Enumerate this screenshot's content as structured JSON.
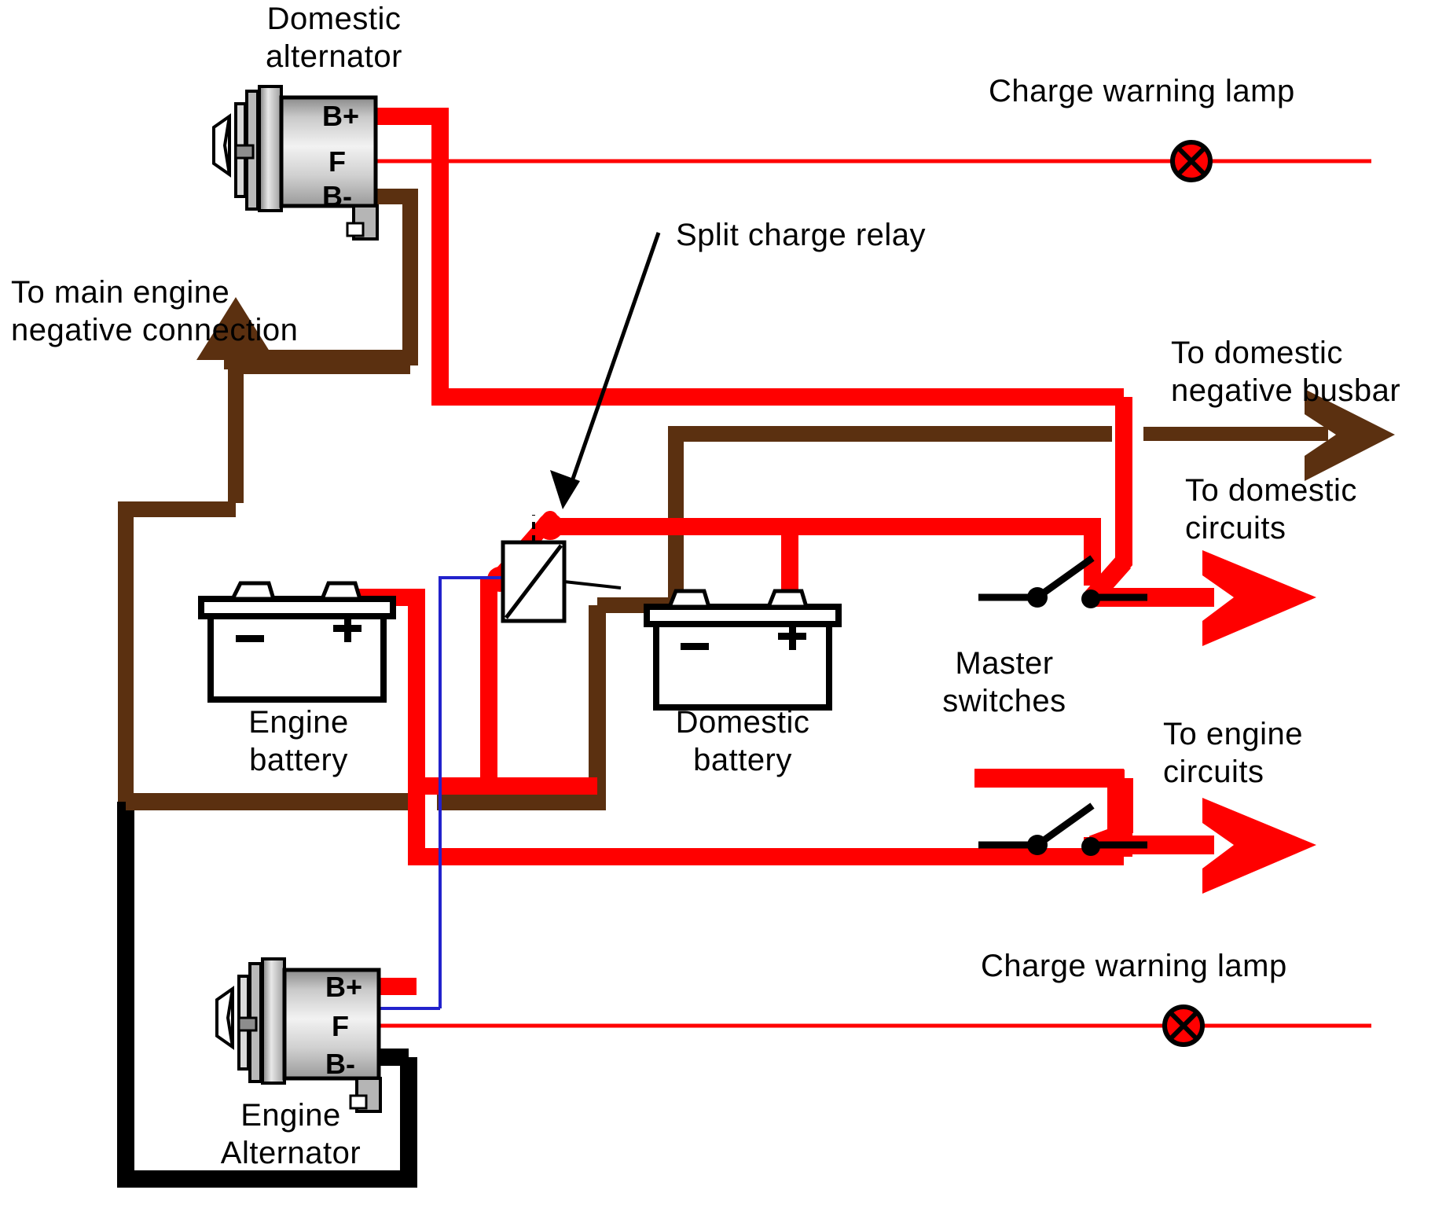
{
  "diagram": {
    "title": "Split charge relay marine electrical wiring diagram",
    "background": "#ffffff",
    "colors": {
      "positive_red": "#ff0000",
      "negative_brown": "#5b3010",
      "earth_black": "#000000",
      "field_blue": "#2222cc",
      "lamp_red": "#ff0000",
      "text_black": "#000000"
    }
  },
  "labels": {
    "domestic_alternator": "Domestic\nalternator",
    "charge_warning_lamp_top": "Charge warning lamp",
    "split_charge_relay": "Split charge relay",
    "to_main_engine_negative": "To main engine\nnegative connection",
    "to_domestic_negative_busbar": "To domestic\nnegative busbar",
    "to_domestic_circuits": "To domestic\ncircuits",
    "engine_battery": "Engine\nbattery",
    "domestic_battery": "Domestic\nbattery",
    "master_switches": "Master\nswitches",
    "to_engine_circuits": "To engine\ncircuits",
    "charge_warning_lamp_bottom": "Charge warning lamp",
    "engine_alternator": "Engine\nAlternator"
  },
  "alternators": [
    {
      "id": "domestic-alternator",
      "name": "Domestic alternator",
      "terminals": [
        "B+",
        "F",
        "B-"
      ]
    },
    {
      "id": "engine-alternator",
      "name": "Engine Alternator",
      "terminals": [
        "B+",
        "F",
        "B-"
      ]
    }
  ],
  "batteries": [
    {
      "id": "engine-battery",
      "name": "Engine battery",
      "negative_marker": "–",
      "positive_marker": "+"
    },
    {
      "id": "domestic-battery",
      "name": "Domestic battery",
      "negative_marker": "–",
      "positive_marker": "+"
    }
  ],
  "components": [
    {
      "id": "split-charge-relay",
      "name": "Split charge relay",
      "type": "relay"
    },
    {
      "id": "master-switch-domestic",
      "name": "Master switch (domestic)",
      "type": "switch",
      "state": "open"
    },
    {
      "id": "master-switch-engine",
      "name": "Master switch (engine)",
      "type": "switch",
      "state": "open"
    },
    {
      "id": "charge-warning-lamp-domestic",
      "name": "Charge warning lamp (domestic)",
      "type": "lamp"
    },
    {
      "id": "charge-warning-lamp-engine",
      "name": "Charge warning lamp (engine)",
      "type": "lamp"
    }
  ],
  "terminal_labels": {
    "b_plus": "B+",
    "f": "F",
    "b_minus": "B-"
  }
}
